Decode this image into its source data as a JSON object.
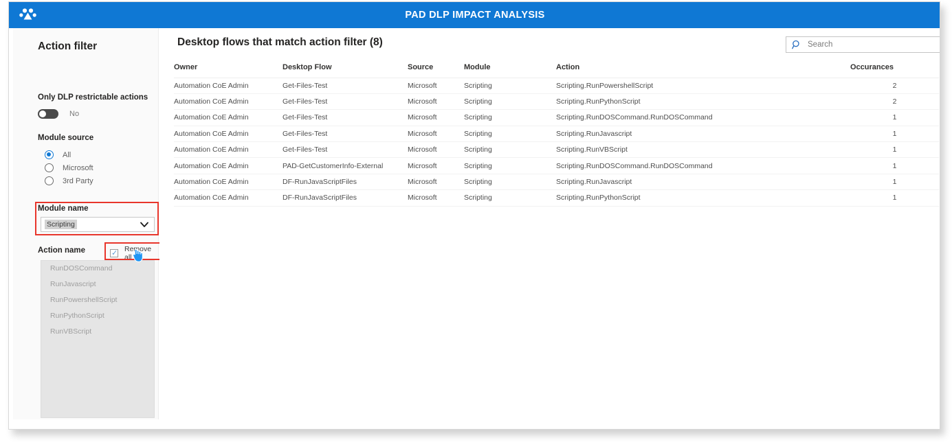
{
  "header": {
    "title": "PAD DLP IMPACT ANALYSIS",
    "logo_icon": "paw-cluster-icon",
    "background": "#0f78d4"
  },
  "sidebar": {
    "title": "Action filter",
    "dlp_restrictable": {
      "label": "Only DLP restrictable actions",
      "toggle_value": "No",
      "toggle_on": false
    },
    "module_source": {
      "label": "Module source",
      "options": [
        {
          "label": "All",
          "selected": true
        },
        {
          "label": "Microsoft",
          "selected": false
        },
        {
          "label": "3rd Party",
          "selected": false
        }
      ]
    },
    "module_name": {
      "label": "Module name",
      "selected": "Scripting",
      "chevron_icon": "chevron-down-icon"
    },
    "action_name": {
      "label": "Action name",
      "remove_all_label": "Remove all",
      "remove_all_checked": true,
      "items": [
        "RunDOSCommand",
        "RunJavascript",
        "RunPowershellScript",
        "RunPythonScript",
        "RunVBScript"
      ]
    },
    "annotation_color": "#e8352b",
    "cursor_icon": "hand-pointer-cursor"
  },
  "main": {
    "title": "Desktop flows that match action filter (8)",
    "search": {
      "placeholder": "Search",
      "value": "",
      "icon": "search-icon"
    },
    "table": {
      "columns": [
        "Owner",
        "Desktop Flow",
        "Source",
        "Module",
        "Action",
        "Occurances"
      ],
      "rows": [
        {
          "owner": "Automation CoE Admin",
          "flow": "Get-Files-Test",
          "source": "Microsoft",
          "module": "Scripting",
          "action": "Scripting.RunPowershellScript",
          "occurances": "2"
        },
        {
          "owner": "Automation CoE Admin",
          "flow": "Get-Files-Test",
          "source": "Microsoft",
          "module": "Scripting",
          "action": "Scripting.RunPythonScript",
          "occurances": "2"
        },
        {
          "owner": "Automation CoE Admin",
          "flow": "Get-Files-Test",
          "source": "Microsoft",
          "module": "Scripting",
          "action": "Scripting.RunDOSCommand.RunDOSCommand",
          "occurances": "1"
        },
        {
          "owner": "Automation CoE Admin",
          "flow": "Get-Files-Test",
          "source": "Microsoft",
          "module": "Scripting",
          "action": "Scripting.RunJavascript",
          "occurances": "1"
        },
        {
          "owner": "Automation CoE Admin",
          "flow": "Get-Files-Test",
          "source": "Microsoft",
          "module": "Scripting",
          "action": "Scripting.RunVBScript",
          "occurances": "1"
        },
        {
          "owner": "Automation CoE Admin",
          "flow": "PAD-GetCustomerInfo-External",
          "source": "Microsoft",
          "module": "Scripting",
          "action": "Scripting.RunDOSCommand.RunDOSCommand",
          "occurances": "1"
        },
        {
          "owner": "Automation CoE Admin",
          "flow": "DF-RunJavaScriptFiles",
          "source": "Microsoft",
          "module": "Scripting",
          "action": "Scripting.RunJavascript",
          "occurances": "1"
        },
        {
          "owner": "Automation CoE Admin",
          "flow": "DF-RunJavaScriptFiles",
          "source": "Microsoft",
          "module": "Scripting",
          "action": "Scripting.RunPythonScript",
          "occurances": "1"
        }
      ]
    }
  },
  "colors": {
    "accent": "#0f78d4",
    "link": "#4d6fb5",
    "annotation": "#e8352b"
  }
}
